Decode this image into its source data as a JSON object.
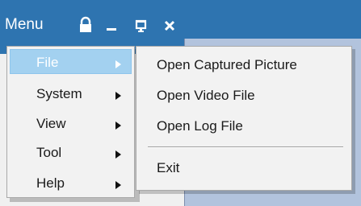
{
  "title_bar": {
    "menu_label": "Menu",
    "buttons": [
      {
        "icon": "lock-icon"
      },
      {
        "icon": "minimize-icon"
      },
      {
        "icon": "restore-icon"
      },
      {
        "icon": "close-icon"
      }
    ]
  },
  "menu": {
    "items": [
      {
        "label": "File",
        "selected": true,
        "icon": "chevron-right-icon"
      },
      {
        "label": "System",
        "icon": "chevron-right-icon"
      },
      {
        "label": "View",
        "icon": "chevron-right-icon"
      },
      {
        "label": "Tool",
        "icon": "chevron-right-icon"
      },
      {
        "label": "Help",
        "icon": "chevron-right-icon"
      }
    ]
  },
  "submenu": {
    "items": [
      {
        "label": "Open Captured Picture"
      },
      {
        "label": "Open Video File"
      },
      {
        "label": "Open Log File"
      },
      {
        "label": "Exit"
      }
    ]
  },
  "colors": {
    "title_bar": "#2e74b0",
    "backdrop": "#b2c3dd",
    "menu_bg": "#f2f2f2",
    "selected_bg": "#a3d1f0"
  }
}
